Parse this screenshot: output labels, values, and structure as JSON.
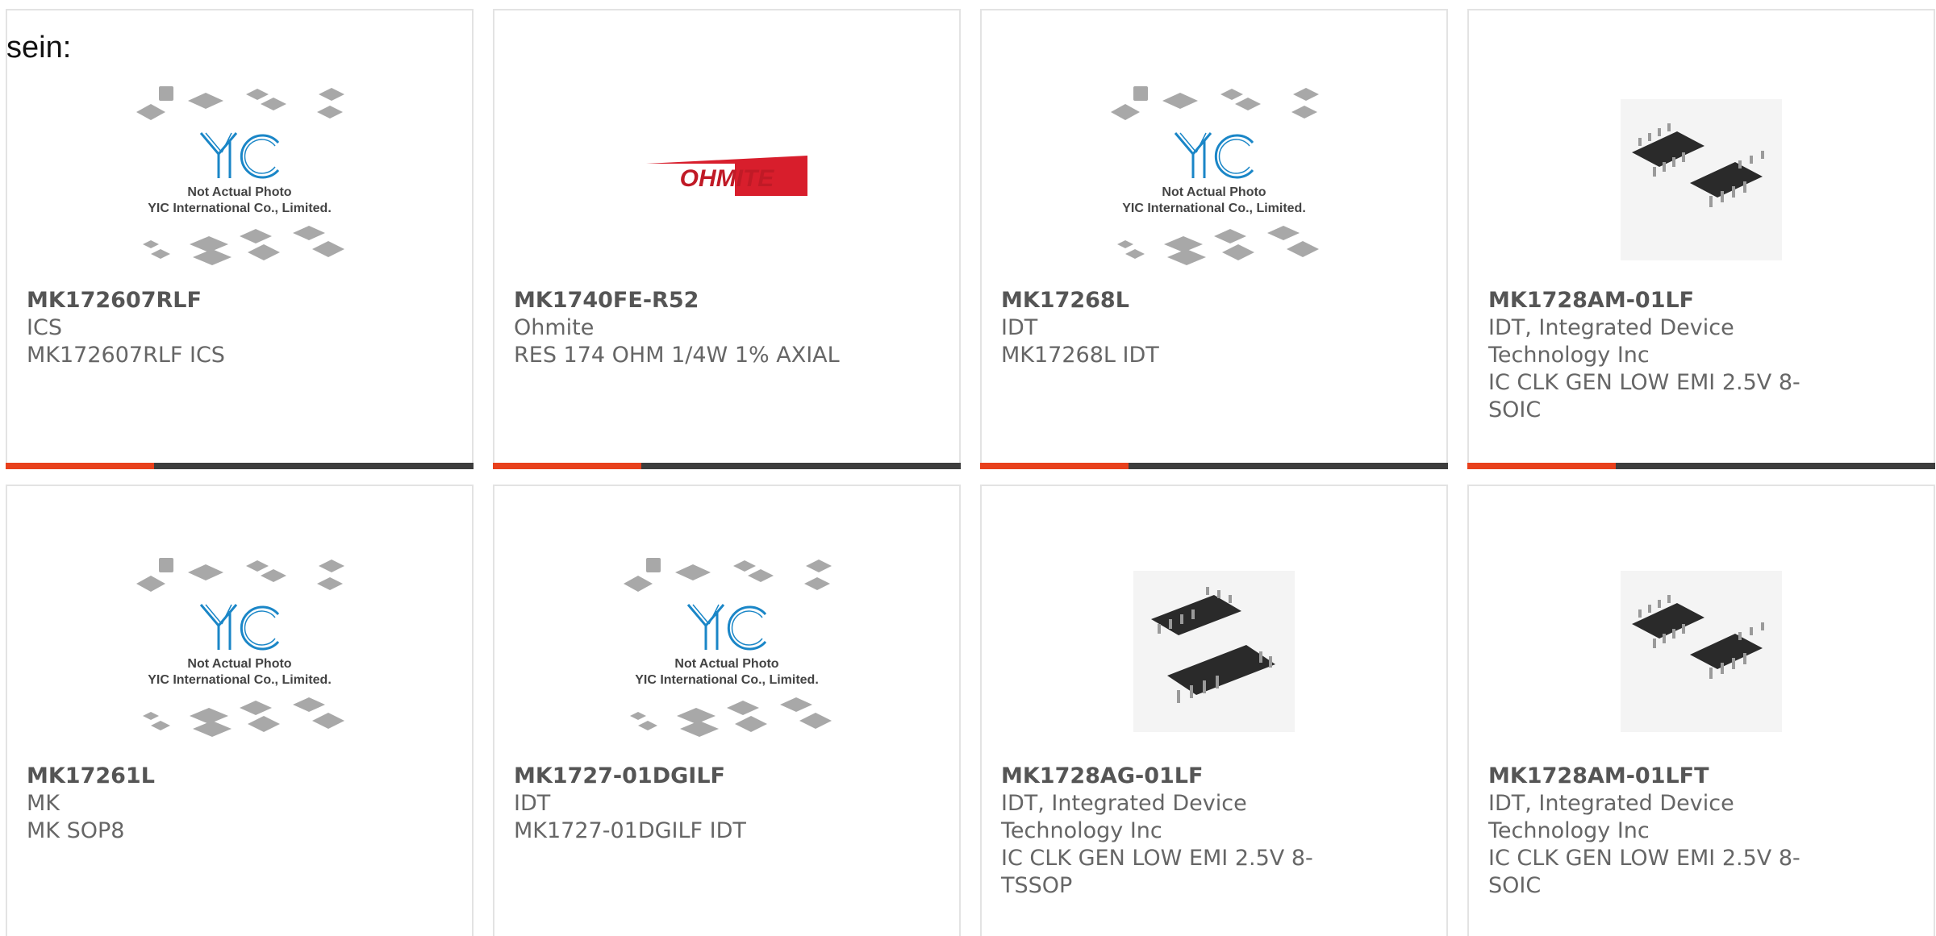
{
  "heading": "sein:",
  "colors": {
    "accent": "#e8401c",
    "bar": "#3d3d3d",
    "text": "#666666",
    "border": "#e3e3e3",
    "yic_blue": "#1a86c7",
    "ohmite_red": "#d81e2c"
  },
  "placeholder": {
    "line1": "Not Actual Photo",
    "line2": "YIC International Co., Limited."
  },
  "ohmite_logo_text": "OHMITE",
  "products": [
    {
      "part_number": "MK172607RLF",
      "manufacturer": "ICS",
      "description": "MK172607RLF ICS",
      "image": "yic-placeholder"
    },
    {
      "part_number": "MK1740FE-R52",
      "manufacturer": "Ohmite",
      "description": "RES 174 OHM 1/4W 1% AXIAL",
      "image": "ohmite-logo"
    },
    {
      "part_number": "MK17268L",
      "manufacturer": "IDT",
      "description": "MK17268L IDT",
      "image": "yic-placeholder"
    },
    {
      "part_number": "MK1728AM-01LF",
      "manufacturer_lines": [
        "IDT, Integrated Device",
        "Technology Inc"
      ],
      "description_lines": [
        "IC CLK GEN LOW EMI 2.5V 8-",
        "SOIC"
      ],
      "image": "soic-8-chip"
    },
    {
      "part_number": "MK17261L",
      "manufacturer": "MK",
      "description": "MK SOP8",
      "image": "yic-placeholder"
    },
    {
      "part_number": "MK1727-01DGILF",
      "manufacturer": "IDT",
      "description": "MK1727-01DGILF IDT",
      "image": "yic-placeholder"
    },
    {
      "part_number": "MK1728AG-01LF",
      "manufacturer_lines": [
        "IDT, Integrated Device",
        "Technology Inc"
      ],
      "description_lines": [
        "IC CLK GEN LOW EMI 2.5V 8-",
        "TSSOP"
      ],
      "image": "tssop-8-chip"
    },
    {
      "part_number": "MK1728AM-01LFT",
      "manufacturer_lines": [
        "IDT, Integrated Device",
        "Technology Inc"
      ],
      "description_lines": [
        "IC CLK GEN LOW EMI 2.5V 8-",
        "SOIC"
      ],
      "image": "soic-8-chip"
    }
  ]
}
